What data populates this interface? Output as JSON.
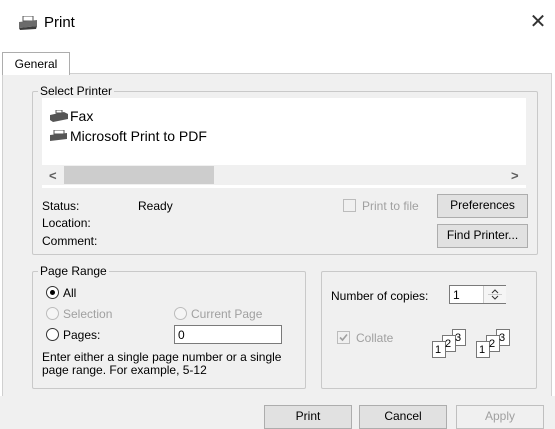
{
  "window": {
    "title": "Print",
    "close_symbol": "✕"
  },
  "tabs": [
    {
      "label": "General"
    }
  ],
  "select_printer": {
    "group_label": "Select Printer",
    "printers": [
      {
        "name": "Fax",
        "icon": "fax-icon"
      },
      {
        "name": "Microsoft Print to PDF",
        "icon": "printer-icon"
      }
    ],
    "scroll_left": "<",
    "scroll_right": ">",
    "status_label": "Status:",
    "status_value": "Ready",
    "location_label": "Location:",
    "comment_label": "Comment:",
    "print_to_file_label": "Print to file",
    "preferences_label": "Preferences",
    "find_printer_label": "Find Printer..."
  },
  "page_range": {
    "group_label": "Page Range",
    "all_label": "All",
    "selection_label": "Selection",
    "current_page_label": "Current Page",
    "pages_label": "Pages:",
    "pages_value": "0",
    "hint": "Enter either a single page number or a single page range.  For example, 5-12",
    "selected": "All"
  },
  "copies": {
    "label": "Number of copies:",
    "value": "1",
    "collate_label": "Collate",
    "collate_checked": true,
    "collate_glyphs": [
      "1",
      "2",
      "3"
    ]
  },
  "footer": {
    "print_label": "Print",
    "cancel_label": "Cancel",
    "apply_label": "Apply"
  }
}
